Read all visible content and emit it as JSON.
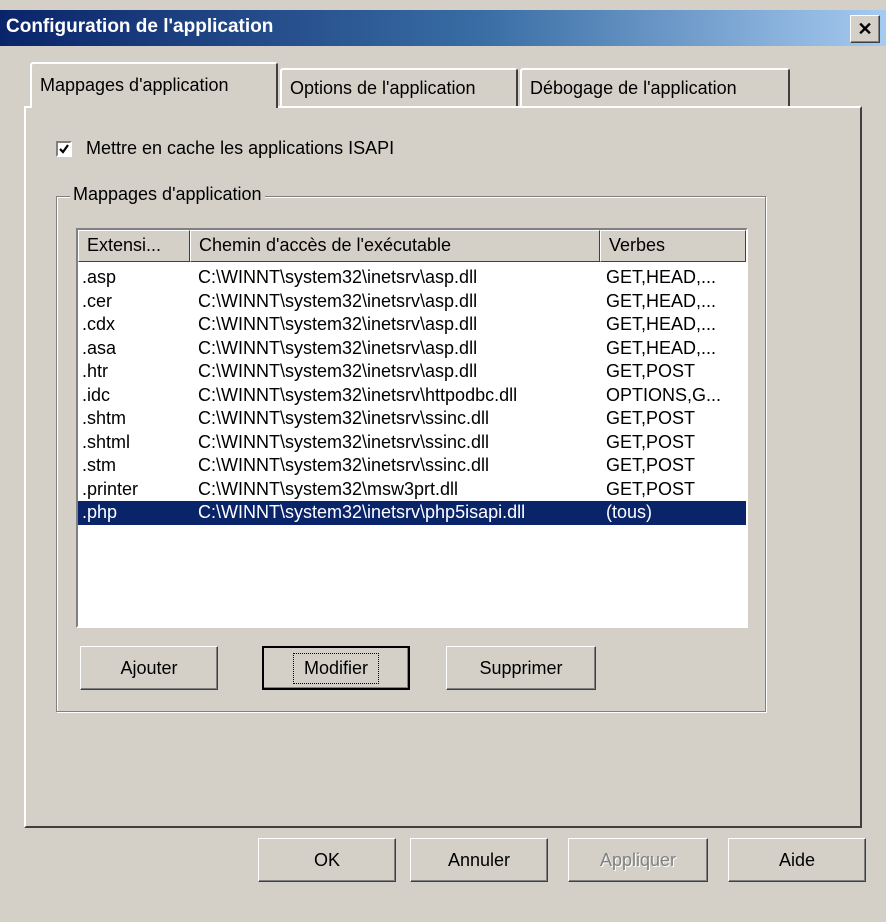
{
  "window": {
    "title": "Configuration de l'application",
    "close_glyph": "✕"
  },
  "tabs": [
    {
      "label": "Mappages d'application",
      "active": true
    },
    {
      "label": "Options de l'application",
      "active": false
    },
    {
      "label": "Débogage de l'application",
      "active": false
    }
  ],
  "cache_checkbox": {
    "label": "Mettre en cache les applications ISAPI",
    "checked": true
  },
  "group": {
    "label": "Mappages d'application"
  },
  "list": {
    "columns": [
      "Extensi...",
      "Chemin d'accès de l'exécutable",
      "Verbes"
    ],
    "rows": [
      {
        "ext": ".asp",
        "path": "C:\\WINNT\\system32\\inetsrv\\asp.dll",
        "verbs": "GET,HEAD,..."
      },
      {
        "ext": ".cer",
        "path": "C:\\WINNT\\system32\\inetsrv\\asp.dll",
        "verbs": "GET,HEAD,..."
      },
      {
        "ext": ".cdx",
        "path": "C:\\WINNT\\system32\\inetsrv\\asp.dll",
        "verbs": "GET,HEAD,..."
      },
      {
        "ext": ".asa",
        "path": "C:\\WINNT\\system32\\inetsrv\\asp.dll",
        "verbs": "GET,HEAD,..."
      },
      {
        "ext": ".htr",
        "path": "C:\\WINNT\\system32\\inetsrv\\asp.dll",
        "verbs": "GET,POST"
      },
      {
        "ext": ".idc",
        "path": "C:\\WINNT\\system32\\inetsrv\\httpodbc.dll",
        "verbs": "OPTIONS,G..."
      },
      {
        "ext": ".shtm",
        "path": "C:\\WINNT\\system32\\inetsrv\\ssinc.dll",
        "verbs": "GET,POST"
      },
      {
        "ext": ".shtml",
        "path": "C:\\WINNT\\system32\\inetsrv\\ssinc.dll",
        "verbs": "GET,POST"
      },
      {
        "ext": ".stm",
        "path": "C:\\WINNT\\system32\\inetsrv\\ssinc.dll",
        "verbs": "GET,POST"
      },
      {
        "ext": ".printer",
        "path": "C:\\WINNT\\system32\\msw3prt.dll",
        "verbs": "GET,POST"
      },
      {
        "ext": ".php",
        "path": "C:\\WINNT\\system32\\inetsrv\\php5isapi.dll",
        "verbs": "(tous)",
        "selected": true
      }
    ]
  },
  "group_buttons": {
    "add": "Ajouter",
    "edit": "Modifier",
    "remove": "Supprimer"
  },
  "footer_buttons": {
    "ok": "OK",
    "cancel": "Annuler",
    "apply": "Appliquer",
    "help": "Aide"
  },
  "colors": {
    "titlebar_start": "#0a246a",
    "titlebar_end": "#a6caf0",
    "selection": "#0a246a",
    "face": "#d4d0c8"
  }
}
